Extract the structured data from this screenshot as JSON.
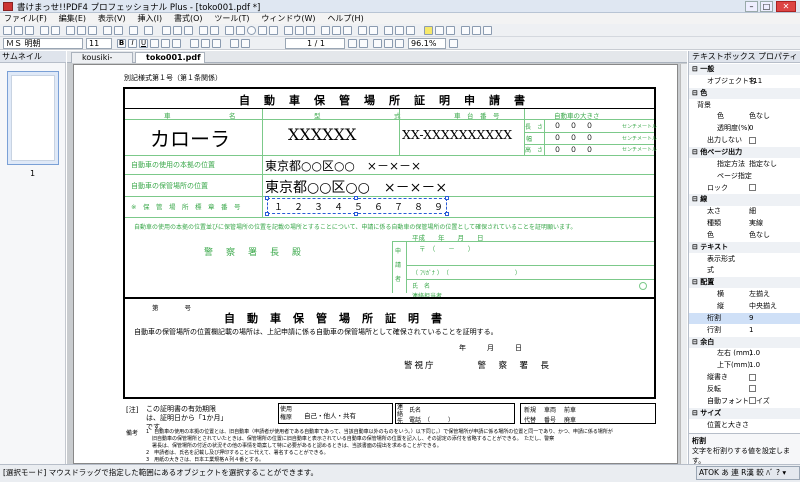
{
  "window": {
    "title": "書けまっせ!!PDF4 プロフェッショナル Plus - [toko001.pdf *]"
  },
  "menu": [
    "ファイル(F)",
    "編集(E)",
    "表示(V)",
    "挿入(I)",
    "書式(O)",
    "ツール(T)",
    "ウィンドウ(W)",
    "ヘルプ(H)"
  ],
  "toolbar": {
    "font_name": "ＭＳ 明朝",
    "font_size": "11",
    "page_indicator": "1 / 1",
    "zoom": "96.1%"
  },
  "thumbnails": {
    "header": "サムネイル",
    "page_label": "1"
  },
  "tabs": [
    {
      "label": "kousiki-1.pdf"
    },
    {
      "label": "toko001.pdf *"
    }
  ],
  "form": {
    "form_number": "別記様式第１号（第１条関係）",
    "title": "自動車保管場所証明申請書",
    "col_headers": [
      "車",
      "名",
      "型",
      "式",
      "車　台　番　号",
      "自動車の大きさ"
    ],
    "car_name": "カローラ",
    "car_model": "XXXXXX",
    "chassis_no": "XX-XXXXXXXXXX",
    "size_rows": [
      {
        "label": "長　さ",
        "unit": "センチメートル"
      },
      {
        "label": "幅",
        "unit": "センチメートル"
      },
      {
        "label": "高　さ",
        "unit": "センチメートル"
      }
    ],
    "size_digit": "０",
    "owner_label": "自動車の使用の本拠の位置",
    "owner_value": "東京都○○区○○　×－×－×",
    "storage_label": "自動車の保管場所の位置",
    "storage_value": "東京都○○区○○　×－×－×",
    "cert_label": "※　保　管　場　所　標　章　番　号",
    "cert_digits": "１　２　３　４　５　６　７　８　９",
    "apply_text": "自動車の使用の本拠の位置並びに保管場所の位置を記載の場所とすることについて、申請に係る自動車の保管場所の位置として確保されていることを証明願います。",
    "date_label": "平成　　年　　月　　日",
    "police": "警　察　署　長　殿",
    "applicant_side": "申　請　者",
    "applicant_rows": [
      "〒　（　　－　　）",
      "（ ﾌﾘｶﾞﾅ ）　（　　　　　　　　　　　）",
      "氏　名",
      "連絡担当者"
    ],
    "cert_title": "自動車保管場所証明書",
    "cert_no": "第　　　　号",
    "cert_text": "自動車の保管場所の位置欄記載の場所は、上記申請に係る自動車の保管場所として確保されていることを証明する。",
    "cert_date": "年　　　月　　　日",
    "cert_police": "警視庁　　　　警　察　署　長",
    "note_title": "[注]",
    "note_text": "この証明書の有効期限は、証明日から「1か月」です。",
    "use_label": "使用権原",
    "use_value": "自己・他人・共有",
    "contact_label": "連絡先",
    "contact_rows": [
      "氏名",
      "電話　（　　　）"
    ],
    "extra_labels": [
      "新規",
      "車両",
      "前車",
      "代替",
      "番号",
      "廃車"
    ],
    "remarks_label": "備考",
    "remarks": [
      "1　自動車の使用の本拠の位置とは、旧自動車（申請者が使用者である自動車であって、当該自動車以外のものをいう。）以下同じ。）で保管場所が申請に係る場所の位置と同一であり、かつ、申請に係る場所が",
      "旧自動車の保管場所とされていたときは、保管場所の位置に旧自動車と表示されている自動車の保管場所の位置を記入し、その認定の添付を省略することができる。　ただし、警察",
      "署長は、保管場所の付近の状況その他の事情を勘案して特に必要があると認めるときは、当該書面の提出を求めることができる。",
      "2　申請者は、氏名を記載し及び押印することに代えて、署名することができる。",
      "3　用紙の大きさは、日本工業規格Ａ列４番とする。"
    ]
  },
  "properties": {
    "header": "テキストボックス プロパティ",
    "rows": [
      {
        "type": "cat",
        "label": "一般"
      },
      {
        "k": "オブジェクト名",
        "v": "T11",
        "indent": 1
      },
      {
        "type": "cat",
        "label": "色"
      },
      {
        "k": "背景",
        "v": "",
        "indent": 0
      },
      {
        "k": "色",
        "v": "色なし",
        "indent": 2
      },
      {
        "k": "透明度(%)",
        "v": "0",
        "indent": 2
      },
      {
        "k": "出力しない",
        "v": "chk",
        "indent": 1
      },
      {
        "type": "cat",
        "label": "他ページ出力"
      },
      {
        "k": "指定方法",
        "v": "指定なし",
        "indent": 2
      },
      {
        "k": "ページ指定",
        "v": "",
        "indent": 2
      },
      {
        "k": "ロック",
        "v": "chk",
        "indent": 1
      },
      {
        "type": "cat",
        "label": "線"
      },
      {
        "k": "太さ",
        "v": "細",
        "indent": 1
      },
      {
        "k": "種類",
        "v": "実線",
        "indent": 1
      },
      {
        "k": "色",
        "v": "色なし",
        "indent": 1
      },
      {
        "type": "cat",
        "label": "テキスト"
      },
      {
        "k": "表示形式",
        "v": "",
        "indent": 1
      },
      {
        "k": "式",
        "v": "",
        "indent": 1
      },
      {
        "type": "cat",
        "label": "配置"
      },
      {
        "k": "横",
        "v": "左揃え",
        "indent": 2
      },
      {
        "k": "縦",
        "v": "中央揃え",
        "indent": 2
      },
      {
        "k": "桁割",
        "v": "9",
        "indent": 1,
        "sel": true
      },
      {
        "k": "行割",
        "v": "1",
        "indent": 1
      },
      {
        "type": "cat",
        "label": "余白"
      },
      {
        "k": "左右 (mm)",
        "v": "1.0",
        "indent": 2
      },
      {
        "k": "上下(mm)",
        "v": "1.0",
        "indent": 2
      },
      {
        "k": "縦書き",
        "v": "chk",
        "indent": 1
      },
      {
        "k": "反転",
        "v": "chk",
        "indent": 1
      },
      {
        "k": "自動フォントサイズ",
        "v": "chk",
        "indent": 1
      },
      {
        "type": "cat",
        "label": "サイズ"
      },
      {
        "k": "位置と大きさ",
        "v": "",
        "indent": 1
      }
    ],
    "desc_title": "桁割",
    "desc_text": "文字を桁割りする値を設定します。"
  },
  "status": {
    "text": "[選択モード] マウスドラッグで指定した範囲にあるオブジェクトを選択することができます。",
    "ime": "ATOK あ 連 R漢 較 ﾊﾞ ? ▾"
  }
}
